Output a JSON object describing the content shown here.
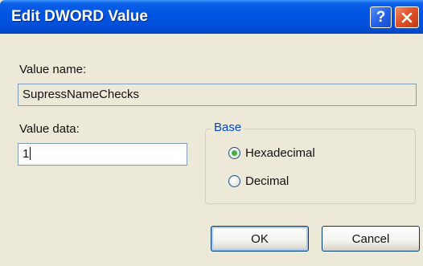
{
  "window": {
    "title": "Edit DWORD Value",
    "help_glyph": "?",
    "close_icon": "close-x-icon"
  },
  "value_name": {
    "label": "Value name:",
    "value": "SupressNameChecks"
  },
  "value_data": {
    "label": "Value data:",
    "value": "1"
  },
  "base": {
    "legend": "Base",
    "options": [
      {
        "label": "Hexadecimal",
        "checked": true
      },
      {
        "label": "Decimal",
        "checked": false
      }
    ]
  },
  "buttons": {
    "ok": "OK",
    "cancel": "Cancel"
  },
  "colors": {
    "titlebar": "#0054e3",
    "legend_text": "#0046d5",
    "close_button": "#e0522a",
    "dialog_bg": "#ece9d8"
  }
}
